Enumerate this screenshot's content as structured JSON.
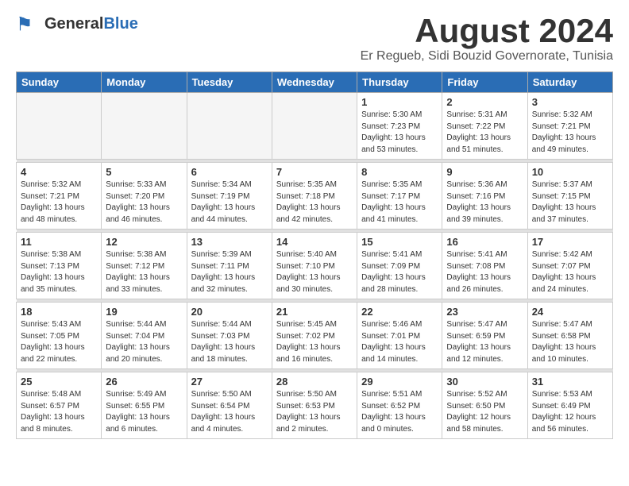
{
  "header": {
    "logo_general": "General",
    "logo_blue": "Blue",
    "month_title": "August 2024",
    "subtitle": "Er Regueb, Sidi Bouzid Governorate, Tunisia"
  },
  "days_of_week": [
    "Sunday",
    "Monday",
    "Tuesday",
    "Wednesday",
    "Thursday",
    "Friday",
    "Saturday"
  ],
  "weeks": [
    [
      {
        "day": "",
        "info": ""
      },
      {
        "day": "",
        "info": ""
      },
      {
        "day": "",
        "info": ""
      },
      {
        "day": "",
        "info": ""
      },
      {
        "day": "1",
        "info": "Sunrise: 5:30 AM\nSunset: 7:23 PM\nDaylight: 13 hours\nand 53 minutes."
      },
      {
        "day": "2",
        "info": "Sunrise: 5:31 AM\nSunset: 7:22 PM\nDaylight: 13 hours\nand 51 minutes."
      },
      {
        "day": "3",
        "info": "Sunrise: 5:32 AM\nSunset: 7:21 PM\nDaylight: 13 hours\nand 49 minutes."
      }
    ],
    [
      {
        "day": "4",
        "info": "Sunrise: 5:32 AM\nSunset: 7:21 PM\nDaylight: 13 hours\nand 48 minutes."
      },
      {
        "day": "5",
        "info": "Sunrise: 5:33 AM\nSunset: 7:20 PM\nDaylight: 13 hours\nand 46 minutes."
      },
      {
        "day": "6",
        "info": "Sunrise: 5:34 AM\nSunset: 7:19 PM\nDaylight: 13 hours\nand 44 minutes."
      },
      {
        "day": "7",
        "info": "Sunrise: 5:35 AM\nSunset: 7:18 PM\nDaylight: 13 hours\nand 42 minutes."
      },
      {
        "day": "8",
        "info": "Sunrise: 5:35 AM\nSunset: 7:17 PM\nDaylight: 13 hours\nand 41 minutes."
      },
      {
        "day": "9",
        "info": "Sunrise: 5:36 AM\nSunset: 7:16 PM\nDaylight: 13 hours\nand 39 minutes."
      },
      {
        "day": "10",
        "info": "Sunrise: 5:37 AM\nSunset: 7:15 PM\nDaylight: 13 hours\nand 37 minutes."
      }
    ],
    [
      {
        "day": "11",
        "info": "Sunrise: 5:38 AM\nSunset: 7:13 PM\nDaylight: 13 hours\nand 35 minutes."
      },
      {
        "day": "12",
        "info": "Sunrise: 5:38 AM\nSunset: 7:12 PM\nDaylight: 13 hours\nand 33 minutes."
      },
      {
        "day": "13",
        "info": "Sunrise: 5:39 AM\nSunset: 7:11 PM\nDaylight: 13 hours\nand 32 minutes."
      },
      {
        "day": "14",
        "info": "Sunrise: 5:40 AM\nSunset: 7:10 PM\nDaylight: 13 hours\nand 30 minutes."
      },
      {
        "day": "15",
        "info": "Sunrise: 5:41 AM\nSunset: 7:09 PM\nDaylight: 13 hours\nand 28 minutes."
      },
      {
        "day": "16",
        "info": "Sunrise: 5:41 AM\nSunset: 7:08 PM\nDaylight: 13 hours\nand 26 minutes."
      },
      {
        "day": "17",
        "info": "Sunrise: 5:42 AM\nSunset: 7:07 PM\nDaylight: 13 hours\nand 24 minutes."
      }
    ],
    [
      {
        "day": "18",
        "info": "Sunrise: 5:43 AM\nSunset: 7:05 PM\nDaylight: 13 hours\nand 22 minutes."
      },
      {
        "day": "19",
        "info": "Sunrise: 5:44 AM\nSunset: 7:04 PM\nDaylight: 13 hours\nand 20 minutes."
      },
      {
        "day": "20",
        "info": "Sunrise: 5:44 AM\nSunset: 7:03 PM\nDaylight: 13 hours\nand 18 minutes."
      },
      {
        "day": "21",
        "info": "Sunrise: 5:45 AM\nSunset: 7:02 PM\nDaylight: 13 hours\nand 16 minutes."
      },
      {
        "day": "22",
        "info": "Sunrise: 5:46 AM\nSunset: 7:01 PM\nDaylight: 13 hours\nand 14 minutes."
      },
      {
        "day": "23",
        "info": "Sunrise: 5:47 AM\nSunset: 6:59 PM\nDaylight: 13 hours\nand 12 minutes."
      },
      {
        "day": "24",
        "info": "Sunrise: 5:47 AM\nSunset: 6:58 PM\nDaylight: 13 hours\nand 10 minutes."
      }
    ],
    [
      {
        "day": "25",
        "info": "Sunrise: 5:48 AM\nSunset: 6:57 PM\nDaylight: 13 hours\nand 8 minutes."
      },
      {
        "day": "26",
        "info": "Sunrise: 5:49 AM\nSunset: 6:55 PM\nDaylight: 13 hours\nand 6 minutes."
      },
      {
        "day": "27",
        "info": "Sunrise: 5:50 AM\nSunset: 6:54 PM\nDaylight: 13 hours\nand 4 minutes."
      },
      {
        "day": "28",
        "info": "Sunrise: 5:50 AM\nSunset: 6:53 PM\nDaylight: 13 hours\nand 2 minutes."
      },
      {
        "day": "29",
        "info": "Sunrise: 5:51 AM\nSunset: 6:52 PM\nDaylight: 13 hours\nand 0 minutes."
      },
      {
        "day": "30",
        "info": "Sunrise: 5:52 AM\nSunset: 6:50 PM\nDaylight: 12 hours\nand 58 minutes."
      },
      {
        "day": "31",
        "info": "Sunrise: 5:53 AM\nSunset: 6:49 PM\nDaylight: 12 hours\nand 56 minutes."
      }
    ]
  ]
}
